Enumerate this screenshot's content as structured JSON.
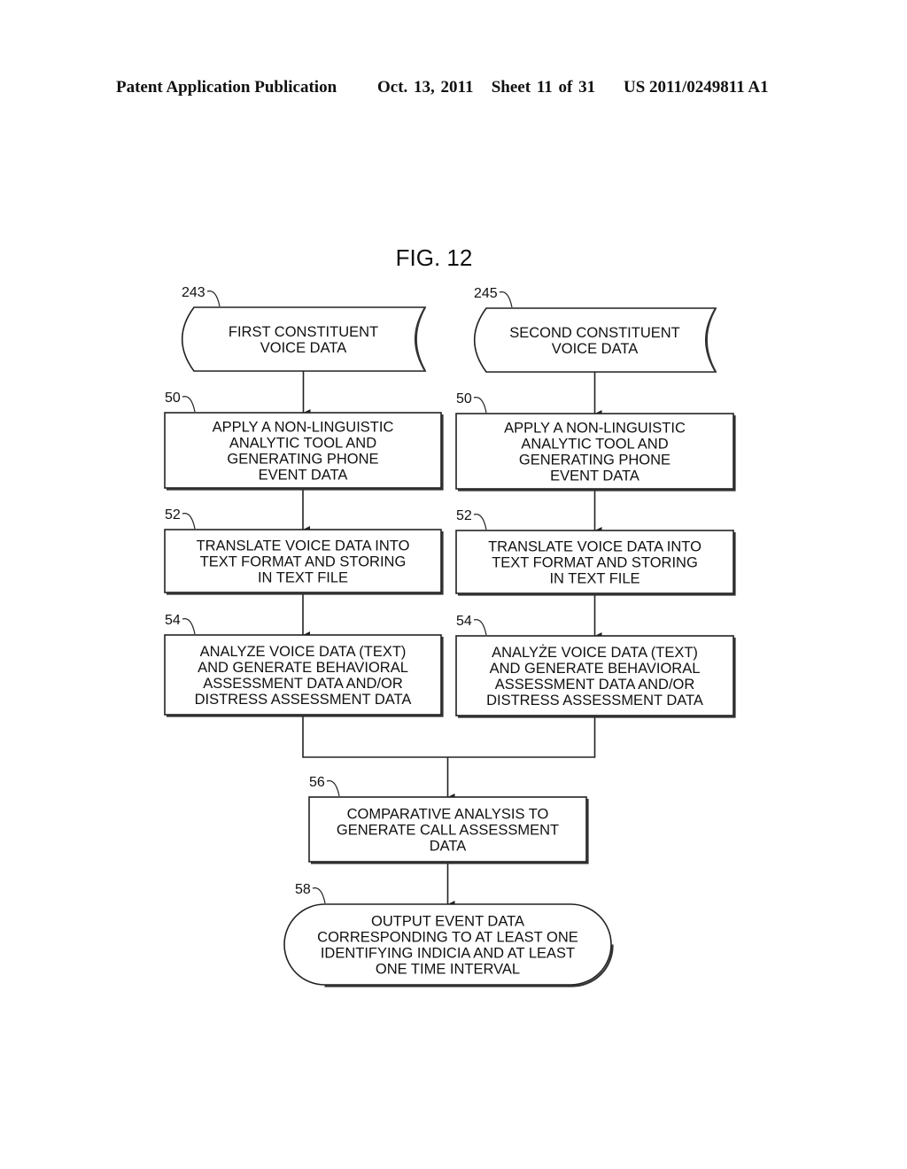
{
  "header": {
    "publication": "Patent Application Publication",
    "date_sheet": "Oct. 13, 2011   Sheet 11 of 31",
    "patent_number": "US 2011/0249811 A1"
  },
  "figure": {
    "title": "FIG. 12",
    "nodes": [
      {
        "id": "first-voice",
        "ref": "243",
        "shape": "data",
        "lines": [
          "FIRST CONSTITUENT",
          "VOICE DATA"
        ]
      },
      {
        "id": "second-voice",
        "ref": "245",
        "shape": "data",
        "lines": [
          "SECOND CONSTITUENT",
          "VOICE DATA"
        ]
      },
      {
        "id": "left-50",
        "ref": "50",
        "shape": "process",
        "lines": [
          "APPLY A NON-LINGUISTIC",
          "ANALYTIC TOOL AND",
          "GENERATING PHONE",
          "EVENT DATA"
        ]
      },
      {
        "id": "right-50",
        "ref": "50",
        "shape": "process",
        "lines": [
          "APPLY A NON-LINGUISTIC",
          "ANALYTIC TOOL AND",
          "GENERATING PHONE",
          "EVENT DATA"
        ]
      },
      {
        "id": "left-52",
        "ref": "52",
        "shape": "process",
        "lines": [
          "TRANSLATE VOICE DATA INTO",
          "TEXT FORMAT AND STORING",
          "IN TEXT FILE"
        ]
      },
      {
        "id": "right-52",
        "ref": "52",
        "shape": "process",
        "lines": [
          "TRANSLATE VOICE DATA INTO",
          "TEXT  FORMAT AND STORING",
          "IN TEXT FILE"
        ]
      },
      {
        "id": "left-54",
        "ref": "54",
        "shape": "process",
        "lines": [
          "ANALYZE VOICE DATA (TEXT)",
          "AND GENERATE BEHAVIORAL",
          "ASSESSMENT DATA AND/OR",
          "DISTRESS ASSESSMENT DATA"
        ]
      },
      {
        "id": "right-54",
        "ref": "54",
        "shape": "process",
        "lines": [
          "ANALYŻE VOICE DATA (TEXT)",
          "AND GENERATE BEHAVIORAL",
          "ASSESSMENT DATA AND/OR",
          "DISTRESS ASSESSMENT DATA"
        ]
      },
      {
        "id": "compare-56",
        "ref": "56",
        "shape": "process",
        "lines": [
          "COMPARATIVE ANALYSIS TO",
          "GENERATE CALL ASSESSMENT",
          "DATA"
        ]
      },
      {
        "id": "output-58",
        "ref": "58",
        "shape": "terminator",
        "lines": [
          "OUTPUT EVENT DATA",
          "CORRESPONDING TO AT LEAST ONE",
          "IDENTIFYING INDICIA AND AT LEAST",
          "ONE TIME INTERVAL"
        ]
      }
    ],
    "edges": [
      {
        "from": "first-voice",
        "to": "left-50"
      },
      {
        "from": "left-50",
        "to": "left-52"
      },
      {
        "from": "left-52",
        "to": "left-54"
      },
      {
        "from": "second-voice",
        "to": "right-50"
      },
      {
        "from": "right-50",
        "to": "right-52"
      },
      {
        "from": "right-52",
        "to": "right-54"
      },
      {
        "from": "left-54",
        "to": "compare-56"
      },
      {
        "from": "right-54",
        "to": "compare-56"
      },
      {
        "from": "compare-56",
        "to": "output-58"
      }
    ]
  }
}
